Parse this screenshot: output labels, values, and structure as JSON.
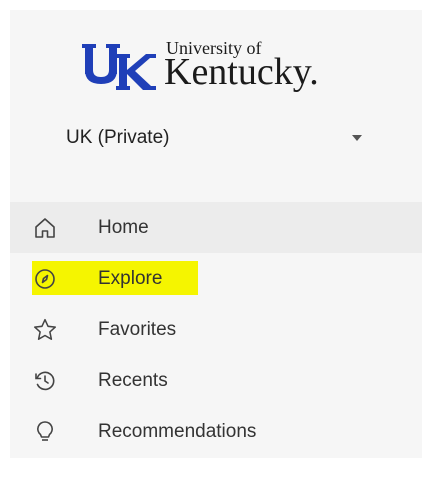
{
  "logo": {
    "line1": "University of",
    "line2": "Kentucky.",
    "mark_icon": "uk-logo-mark",
    "brand_color": "#1f3fb8"
  },
  "site_selector": {
    "label": "UK (Private)",
    "icon": "caret-down-icon"
  },
  "nav": {
    "items": [
      {
        "label": "Home",
        "icon": "home-icon"
      },
      {
        "label": "Explore",
        "icon": "compass-icon",
        "highlighted": true
      },
      {
        "label": "Favorites",
        "icon": "star-icon"
      },
      {
        "label": "Recents",
        "icon": "clock-icon"
      },
      {
        "label": "Recommendations",
        "icon": "lightbulb-icon"
      }
    ],
    "highlight_color": "#f5f500"
  }
}
